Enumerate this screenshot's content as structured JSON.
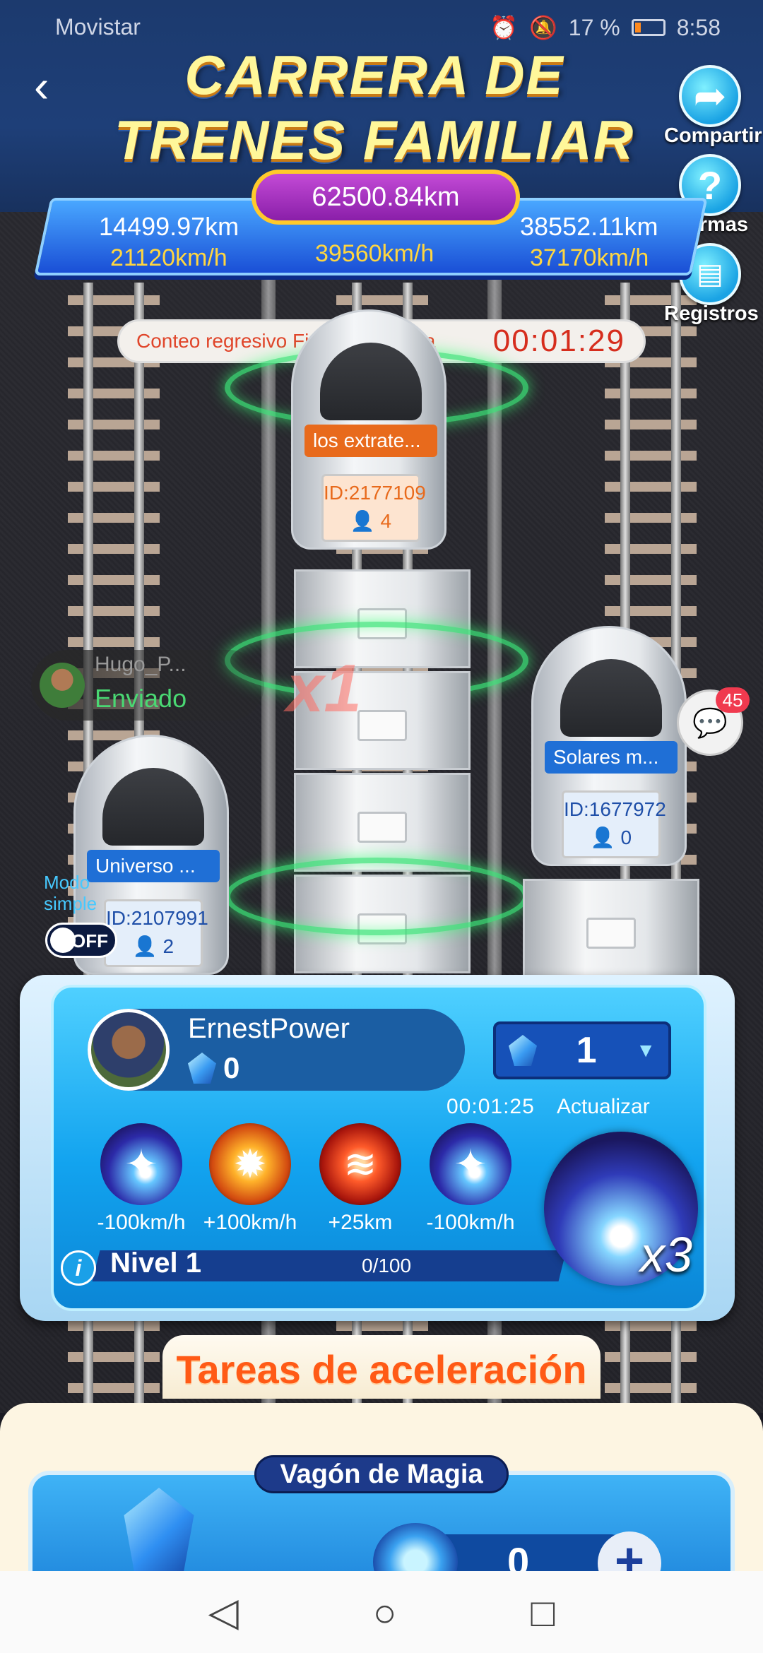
{
  "status_bar": {
    "carrier": "Movistar",
    "battery": "17 %",
    "time": "8:58"
  },
  "header": {
    "title_line1": "CARRERA DE",
    "title_line2": "TRENES FAMILIAR",
    "share_label": "Compartir",
    "rules_label": "Normas",
    "records_label": "Registros"
  },
  "scoreboard": {
    "total_km": "62500.84km",
    "left_km": "14499.97km",
    "left_speed": "21120km/h",
    "center_speed": "39560km/h",
    "right_km": "38552.11km",
    "right_speed": "37170km/h"
  },
  "countdown": {
    "label": "Conteo regresivo Final de Carrera",
    "time": "00:01:29"
  },
  "trains": [
    {
      "name": "Universo ...",
      "id": "ID:2107991",
      "members": "2",
      "color": "#1f6fd6"
    },
    {
      "name": "los extrate...",
      "id": "ID:2177109",
      "members": "4",
      "color": "#e86a1c"
    },
    {
      "name": "Solares m...",
      "id": "ID:1677972",
      "members": "0",
      "color": "#1f6fd6"
    }
  ],
  "notification": {
    "user": "Hugo_P...",
    "status": "Enviado",
    "multiplier": "x1"
  },
  "chat": {
    "badge": "45"
  },
  "simple_mode": {
    "label": "Modo simple",
    "toggle": "OFF"
  },
  "player": {
    "name": "ErnestPower",
    "gems": "0",
    "selected_amount": "1",
    "timer": "00:01:25",
    "update_label": "Actualizar",
    "level": "Nivel 1",
    "progress": "0/100",
    "multiplier": "x3"
  },
  "skills": [
    {
      "label": "-100km/h",
      "icon": "ice-burst-icon"
    },
    {
      "label": "+100km/h",
      "icon": "fire-burst-icon"
    },
    {
      "label": "+25km",
      "icon": "red-spring-icon"
    },
    {
      "label": "-100km/h",
      "icon": "ice-burst-icon"
    }
  ],
  "tasks": {
    "title": "Tareas de aceleración",
    "card_title": "Vagón de Magia",
    "quantity": "0"
  }
}
